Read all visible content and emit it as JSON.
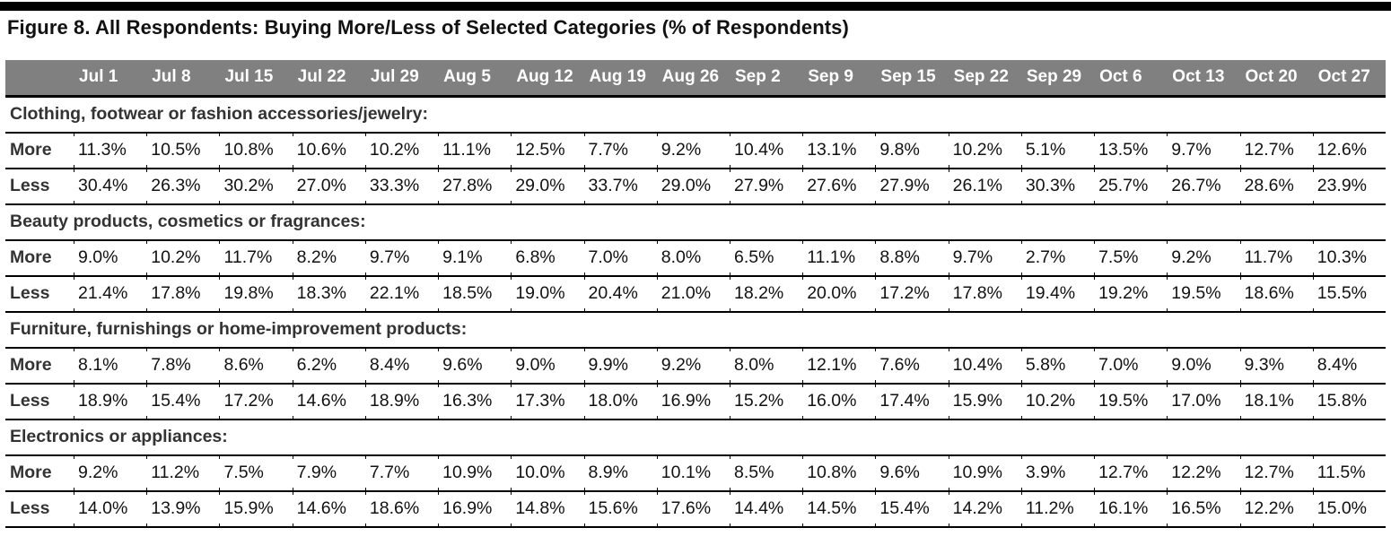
{
  "title": "Figure 8. All Respondents: Buying More/Less of Selected Categories (% of Respondents)",
  "chart_data": {
    "type": "table",
    "title": "Figure 8. All Respondents: Buying More/Less of Selected Categories (% of Respondents)",
    "columns": [
      "Jul 1",
      "Jul 8",
      "Jul 15",
      "Jul 22",
      "Jul 29",
      "Aug 5",
      "Aug 12",
      "Aug 19",
      "Aug 26",
      "Sep 2",
      "Sep 9",
      "Sep 15",
      "Sep 22",
      "Sep 29",
      "Oct 6",
      "Oct 13",
      "Oct 20",
      "Oct 27"
    ],
    "unit": "%",
    "categories": [
      {
        "name": "Clothing, footwear or fashion accessories/jewelry:",
        "rows": [
          {
            "label": "More",
            "values": [
              "11.3%",
              "10.5%",
              "10.8%",
              "10.6%",
              "10.2%",
              "11.1%",
              "12.5%",
              "7.7%",
              "9.2%",
              "10.4%",
              "13.1%",
              "9.8%",
              "10.2%",
              "5.1%",
              "13.5%",
              "9.7%",
              "12.7%",
              "12.6%"
            ]
          },
          {
            "label": "Less",
            "values": [
              "30.4%",
              "26.3%",
              "30.2%",
              "27.0%",
              "33.3%",
              "27.8%",
              "29.0%",
              "33.7%",
              "29.0%",
              "27.9%",
              "27.6%",
              "27.9%",
              "26.1%",
              "30.3%",
              "25.7%",
              "26.7%",
              "28.6%",
              "23.9%"
            ]
          }
        ]
      },
      {
        "name": "Beauty products, cosmetics or fragrances:",
        "rows": [
          {
            "label": "More",
            "values": [
              "9.0%",
              "10.2%",
              "11.7%",
              "8.2%",
              "9.7%",
              "9.1%",
              "6.8%",
              "7.0%",
              "8.0%",
              "6.5%",
              "11.1%",
              "8.8%",
              "9.7%",
              "2.7%",
              "7.5%",
              "9.2%",
              "11.7%",
              "10.3%"
            ]
          },
          {
            "label": "Less",
            "values": [
              "21.4%",
              "17.8%",
              "19.8%",
              "18.3%",
              "22.1%",
              "18.5%",
              "19.0%",
              "20.4%",
              "21.0%",
              "18.2%",
              "20.0%",
              "17.2%",
              "17.8%",
              "19.4%",
              "19.2%",
              "19.5%",
              "18.6%",
              "15.5%"
            ]
          }
        ]
      },
      {
        "name": "Furniture, furnishings or home-improvement products:",
        "rows": [
          {
            "label": "More",
            "values": [
              "8.1%",
              "7.8%",
              "8.6%",
              "6.2%",
              "8.4%",
              "9.6%",
              "9.0%",
              "9.9%",
              "9.2%",
              "8.0%",
              "12.1%",
              "7.6%",
              "10.4%",
              "5.8%",
              "7.0%",
              "9.0%",
              "9.3%",
              "8.4%"
            ]
          },
          {
            "label": "Less",
            "values": [
              "18.9%",
              "15.4%",
              "17.2%",
              "14.6%",
              "18.9%",
              "16.3%",
              "17.3%",
              "18.0%",
              "16.9%",
              "15.2%",
              "16.0%",
              "17.4%",
              "15.9%",
              "10.2%",
              "19.5%",
              "17.0%",
              "18.1%",
              "15.8%"
            ]
          }
        ]
      },
      {
        "name": "Electronics or appliances:",
        "rows": [
          {
            "label": "More",
            "values": [
              "9.2%",
              "11.2%",
              "7.5%",
              "7.9%",
              "7.7%",
              "10.9%",
              "10.0%",
              "8.9%",
              "10.1%",
              "8.5%",
              "10.8%",
              "9.6%",
              "10.9%",
              "3.9%",
              "12.7%",
              "12.2%",
              "12.7%",
              "11.5%"
            ]
          },
          {
            "label": "Less",
            "values": [
              "14.0%",
              "13.9%",
              "15.9%",
              "14.6%",
              "18.6%",
              "16.9%",
              "14.8%",
              "15.6%",
              "17.6%",
              "14.4%",
              "14.5%",
              "15.4%",
              "14.2%",
              "11.2%",
              "16.1%",
              "16.5%",
              "12.2%",
              "15.0%"
            ]
          }
        ]
      }
    ]
  },
  "colors": {
    "header_bg": "#808080",
    "header_text": "#ffffff",
    "rule": "#000000"
  }
}
